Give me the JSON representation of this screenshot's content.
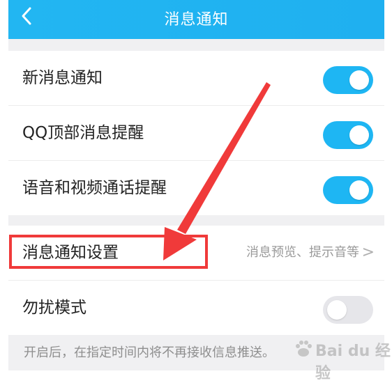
{
  "header": {
    "back_icon": "chevron-left-icon",
    "title": "消息通知"
  },
  "settings": {
    "new_message": {
      "label": "新消息通知",
      "toggle": "on"
    },
    "qq_top_alert": {
      "label": "QQ顶部消息提醒",
      "toggle": "on"
    },
    "voice_video_alert": {
      "label": "语音和视频通话提醒",
      "toggle": "on"
    },
    "notification_settings": {
      "label": "消息通知设置",
      "value": "消息预览、提示音等",
      "chevron": ">"
    },
    "do_not_disturb": {
      "label": "勿扰模式",
      "toggle": "off"
    }
  },
  "footnote": "开启后，在指定时间内将不再接收信息推送。",
  "watermark": {
    "text": "Bai du 经验"
  },
  "colors": {
    "header_bg": "#1fb0f0",
    "toggle_on": "#1eb6f3",
    "toggle_off": "#e6e6ea",
    "annotation": "#f03a3a"
  }
}
